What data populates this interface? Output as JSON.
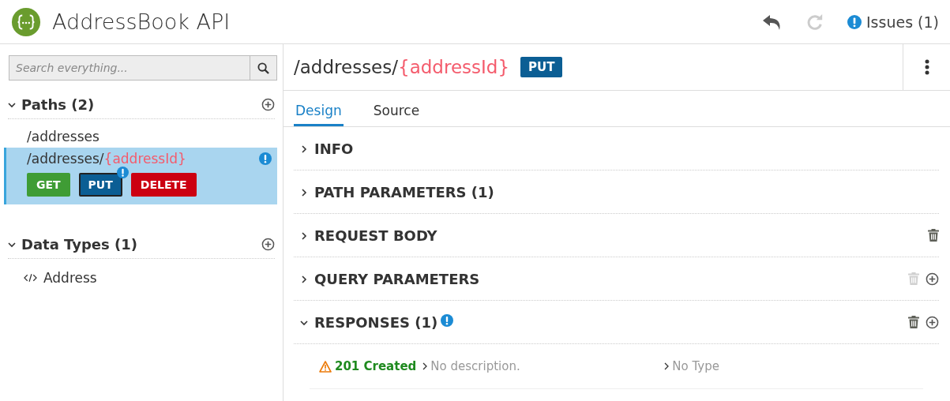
{
  "header": {
    "title": "AddressBook API",
    "undo": {
      "disabled": false
    },
    "redo": {
      "disabled": true
    },
    "issues": "Issues (1)"
  },
  "sidebar": {
    "search": {
      "placeholder": "Search everything..."
    },
    "sections": [
      {
        "title": "Paths (2)",
        "expanded": true,
        "kind": "paths",
        "items": [
          {
            "path": "/addresses",
            "selected": false,
            "issue": false
          },
          {
            "path": "/addresses/",
            "param": "{addressId}",
            "selected": true,
            "issue": true,
            "operations": [
              {
                "method": "GET",
                "color": "#3f9c35",
                "selected": false,
                "issue": false
              },
              {
                "method": "PUT",
                "color": "#0b5e94",
                "selected": true,
                "issue": true
              },
              {
                "method": "DELETE",
                "color": "#cc0011",
                "selected": false,
                "issue": false
              }
            ]
          }
        ]
      },
      {
        "title": "Data Types (1)",
        "expanded": true,
        "kind": "types",
        "items": [
          {
            "name": "Address"
          }
        ]
      }
    ]
  },
  "main": {
    "path": "/addresses/",
    "param": "{addressId}",
    "method": "PUT",
    "tabs": [
      {
        "label": "Design",
        "selected": true
      },
      {
        "label": "Source",
        "selected": false
      }
    ],
    "sections": [
      {
        "title": "INFO",
        "expanded": false,
        "issue": false
      },
      {
        "title": "PATH PARAMETERS (1)",
        "expanded": false,
        "issue": false
      },
      {
        "title": "REQUEST BODY",
        "expanded": false,
        "issue": false,
        "actions": [
          {
            "kind": "delete",
            "disabled": false
          }
        ]
      },
      {
        "title": "QUERY PARAMETERS",
        "expanded": false,
        "issue": false,
        "actions": [
          {
            "kind": "delete",
            "disabled": true
          },
          {
            "kind": "add",
            "disabled": false
          }
        ]
      },
      {
        "title": "RESPONSES (1)",
        "expanded": true,
        "issue": true,
        "actions": [
          {
            "kind": "delete",
            "disabled": false
          },
          {
            "kind": "add",
            "disabled": false
          }
        ],
        "responses": [
          {
            "code": "201 Created",
            "warning": true,
            "description": "No description.",
            "type": "No Type"
          }
        ]
      }
    ]
  }
}
